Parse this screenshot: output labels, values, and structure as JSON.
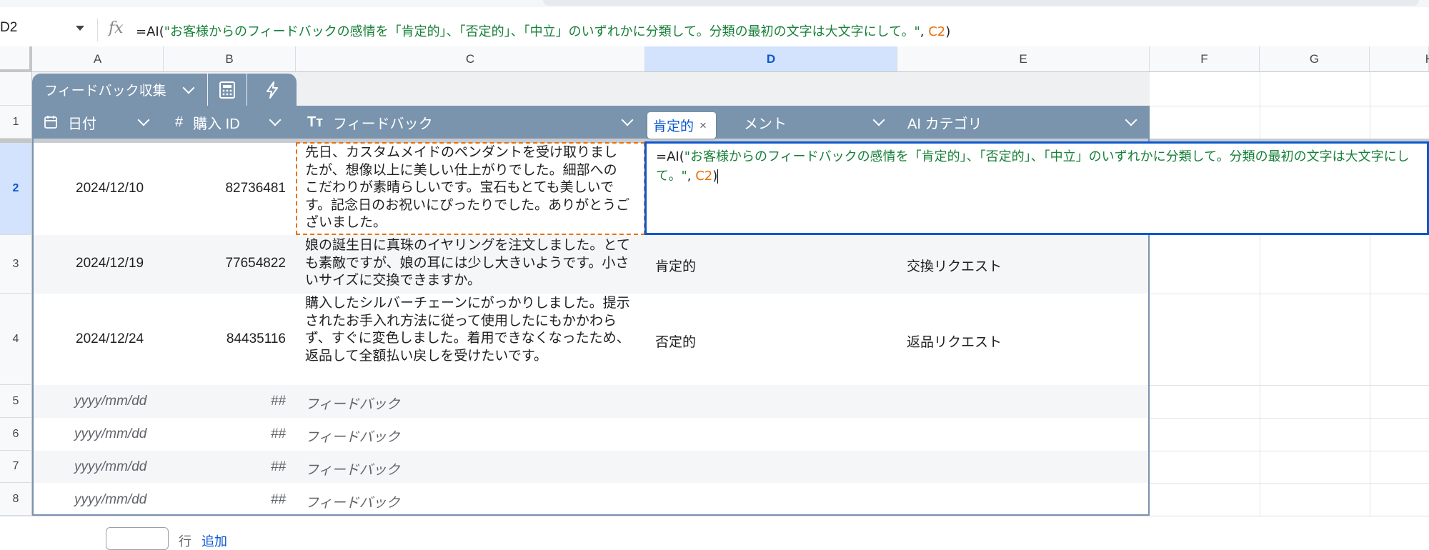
{
  "formula_bar": {
    "cell_ref": "D2",
    "fx_label": "fx",
    "formula": {
      "prefix": "=AI(",
      "string": "\"お客様からのフィードバックの感情を「肯定的」、「否定的」、「中立」のいずれかに分類して。分類の最初の文字は大文字にして。\"",
      "sep": ", ",
      "ref": "C2",
      "suffix": ")"
    }
  },
  "columns": [
    "A",
    "B",
    "C",
    "D",
    "E",
    "F",
    "G",
    "H"
  ],
  "rows": [
    "1",
    "2",
    "3",
    "4",
    "5",
    "6",
    "7",
    "8"
  ],
  "table": {
    "name": "フィードバック収集",
    "headers": {
      "date": "日付",
      "purchase_id": "購入 ID",
      "feedback": "フィードバック",
      "comment": "メント",
      "ai_category": "AI カテゴリ"
    },
    "data_rows": [
      {
        "date": "2024/12/10",
        "id": "82736481",
        "feedback": "先日、カスタムメイドのペンダントを受け取りましたが、想像以上に美しい仕上がりでした。細部へのこだわりが素晴らしいです。宝石もとても美しいです。記念日のお祝いにぴったりでした。ありがとうございました。",
        "comment": "",
        "category": ""
      },
      {
        "date": "2024/12/19",
        "id": "77654822",
        "feedback": "娘の誕生日に真珠のイヤリングを注文しました。とても素敵ですが、娘の耳には少し大きいようです。小さいサイズに交換できますか。",
        "comment": "肯定的",
        "category": "交換リクエスト"
      },
      {
        "date": "2024/12/24",
        "id": "84435116",
        "feedback": "購入したシルバーチェーンにがっかりしました。提示されたお手入れ方法に従って使用したにもかかわらず、すぐに変色しました。着用できなくなったため、返品して全額払い戻しを受けたいです。",
        "comment": "否定的",
        "category": "返品リクエスト"
      }
    ],
    "placeholders": {
      "date": "yyyy/mm/dd",
      "id": "##",
      "feedback": "フィードバック"
    }
  },
  "editor": {
    "chip_label": "肯定的",
    "chip_close": "×"
  },
  "bottom": {
    "text": "行",
    "link": "追加"
  }
}
